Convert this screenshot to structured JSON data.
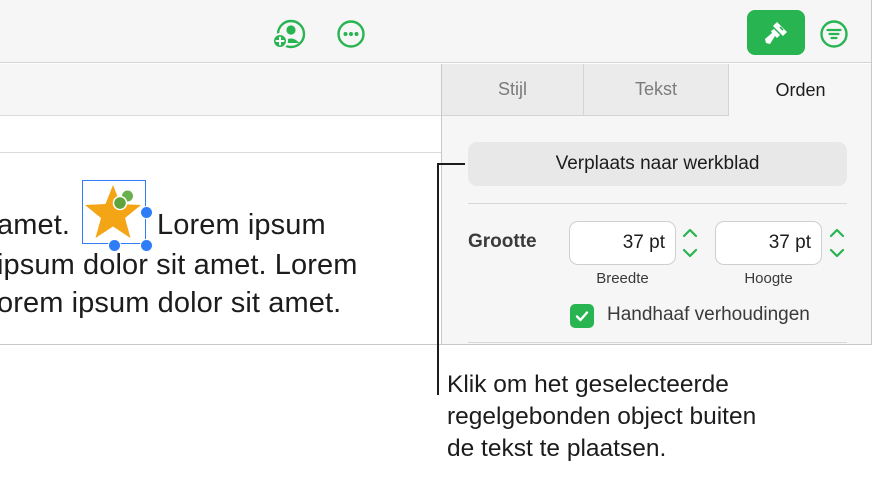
{
  "toolbar": {
    "collaborate_icon": "person-plus-icon",
    "more_icon": "ellipsis-circle-icon",
    "format_icon": "paintbrush-icon",
    "organize_icon": "filter-lines-icon",
    "accent_color": "#29b452"
  },
  "document": {
    "line1_before": "amet.",
    "line1_after": "Lorem ipsum",
    "line2": "ipsum dolor sit amet. Lorem",
    "line3": "orem ipsum dolor sit amet.",
    "inline_object": "star-shape",
    "selection_color": "#2e7cf6"
  },
  "sidebar": {
    "tabs": [
      {
        "label": "Stijl"
      },
      {
        "label": "Tekst"
      },
      {
        "label": "Orden"
      }
    ],
    "move_button_label": "Verplaats naar werkblad",
    "size": {
      "label": "Grootte",
      "width_value": "37 pt",
      "width_caption": "Breedte",
      "height_value": "37 pt",
      "height_caption": "Hoogte"
    },
    "constrain_label": "Handhaaf verhoudingen",
    "constrain_checked": true
  },
  "callout": {
    "line1": "Klik om het geselecteerde",
    "line2": "regelgebonden object buiten",
    "line3": "de tekst te plaatsen."
  }
}
